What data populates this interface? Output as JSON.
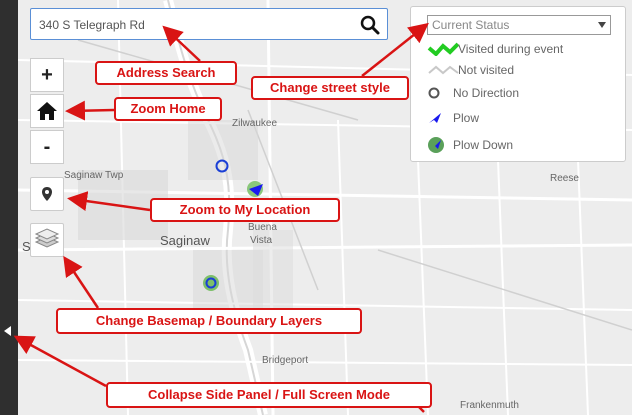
{
  "search": {
    "value": "340 S Telegraph Rd",
    "icon": "search-icon"
  },
  "map_controls": {
    "zoom_in": "+",
    "zoom_out": "-"
  },
  "legend": {
    "select_value": "Current Status",
    "items": [
      {
        "label": "Visited during event",
        "icon": "green-zigzag-line-icon",
        "color": "#22cc22"
      },
      {
        "label": "Not visited",
        "icon": "gray-zigzag-line-icon",
        "color": "#c8c8c8"
      },
      {
        "label": "No Direction",
        "icon": "circle-icon",
        "color": "#555555"
      },
      {
        "label": "Plow",
        "icon": "blue-arrow-icon",
        "color": "#1a1aee"
      },
      {
        "label": "Plow Down",
        "icon": "green-circle-arrow-icon",
        "color": "#5aa05a"
      }
    ]
  },
  "places": {
    "zilwaukee": "Zilwaukee",
    "saginaw_twp": "Saginaw Twp",
    "saginaw": "Saginaw",
    "buena": "Buena",
    "vista": "Vista",
    "reese": "Reese",
    "bridgeport": "Bridgeport",
    "frankenmuth": "Frankenmuth",
    "s_edge": "S"
  },
  "callouts": {
    "address_search": "Address Search",
    "change_street_style": "Change street style",
    "zoom_home": "Zoom Home",
    "zoom_location": "Zoom to My Location",
    "change_basemap": "Change Basemap / Boundary Layers",
    "collapse_panel": "Collapse Side Panel / Full Screen Mode"
  },
  "colors": {
    "callout_red": "#d91414",
    "accent_blue": "#5a8fd6"
  }
}
